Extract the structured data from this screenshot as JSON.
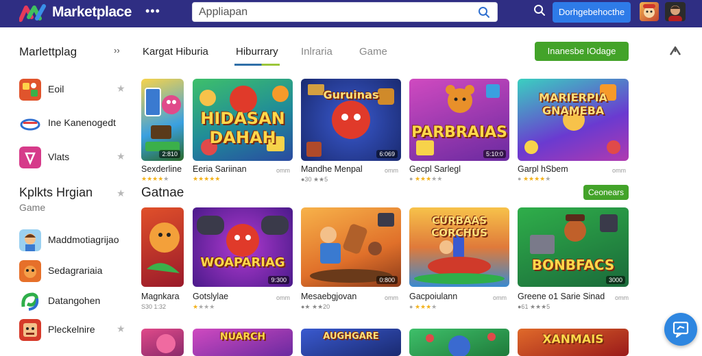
{
  "header": {
    "brand": "Marketplace",
    "more": "•••",
    "search_placeholder": "Appliapan",
    "action_button": "Dorhgebehocthe"
  },
  "sidebar": {
    "title": "Marlettplag",
    "chevron": "››",
    "items": [
      {
        "label": "Eoil",
        "icon": "game-icon",
        "starred": true
      },
      {
        "label": "Ine Kanenogedt",
        "icon": "cloud-icon",
        "starred": false
      },
      {
        "label": "Vlats",
        "icon": "shield-icon",
        "starred": true
      }
    ],
    "section_title": "Kplkts Hrgian",
    "section_subtitle": "Game",
    "section_items": [
      {
        "label": "Maddmotiagrijao"
      },
      {
        "label": "Sedagrariaia"
      },
      {
        "label": "Datangohen"
      },
      {
        "label": "Pleckelnire",
        "starred": true
      }
    ]
  },
  "tabs": [
    {
      "label": "Kargat Hiburia",
      "active": false
    },
    {
      "label": "Hiburrary",
      "active": true
    },
    {
      "label": "Inlraria",
      "active": false
    },
    {
      "label": "Game",
      "active": false
    }
  ],
  "top_button": "Inanesbe IOdage",
  "section_games": "Gatnae",
  "section_games_button": "Ceonears",
  "row1": [
    {
      "title": "Sexderline",
      "art": "",
      "price": "2:810",
      "meta": "",
      "stars": 4
    },
    {
      "title": "Eeria Sariinan",
      "art": "HIDASAN DAHAH",
      "price": "",
      "meta": "omm",
      "stars": 5
    },
    {
      "title": "Mandhe Menpal",
      "art": "Guruinas",
      "price": "6:069",
      "meta": "omm",
      "stars": 0,
      "rating_text": "●30 ★★5"
    },
    {
      "title": "Gecpl Sarlegl",
      "art": "PARBRAIAS",
      "price": "5:10:0",
      "meta": "",
      "stars": 3
    },
    {
      "title": "Garpl hSbem",
      "art": "MARIERPIA GNAMEBA",
      "price": "",
      "meta": "omm",
      "stars": 4
    }
  ],
  "row2": [
    {
      "title": "Magnkara",
      "art": "",
      "price": "",
      "meta": "",
      "rating_text": "S30 1:32"
    },
    {
      "title": "Gotslylae",
      "art": "WOAPARIAG",
      "price": "9:300",
      "meta": "omm",
      "stars": 1
    },
    {
      "title": "Mesaebgjovan",
      "art": "",
      "price": "0:800",
      "meta": "omm",
      "rating_text": "●★ ★★20"
    },
    {
      "title": "Gacpoiulann",
      "art": "CURBAAS CORCHUS",
      "price": "",
      "meta": "omm",
      "stars": 3
    },
    {
      "title": "Greene o1 Sarie Sinad",
      "art": "BONBFACS",
      "price": "3000",
      "meta": "omm",
      "rating_text": "●61 ★★★5"
    }
  ],
  "row3_art": [
    "",
    "NUARCH",
    "AUGHGARE",
    "",
    "XANMAIS"
  ],
  "colors": {
    "header": "#2f2e83",
    "accent_blue": "#2e7be8",
    "accent_green": "#43a329"
  }
}
